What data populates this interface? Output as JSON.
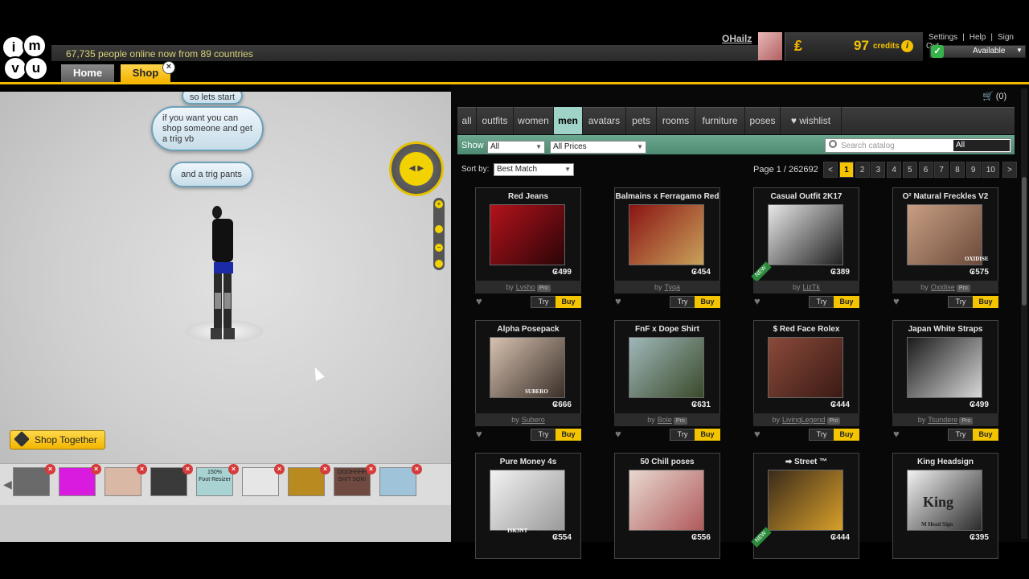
{
  "header": {
    "online_text": "67,735 people online now from 89 countries",
    "tabs": [
      {
        "label": "Home"
      },
      {
        "label": "Shop"
      }
    ],
    "tab_close": "×",
    "username": "OHailz",
    "credits": {
      "coin": "₤",
      "amount": "97",
      "label": "credits",
      "info": "i"
    },
    "links": [
      "Settings",
      "Help",
      "Sign Out"
    ],
    "link_sep": "|",
    "status": {
      "check": "✓",
      "label": "Available",
      "arrow": "▼"
    }
  },
  "scene": {
    "bubbles": [
      {
        "text": "so lets start"
      },
      {
        "text": "if you want you can shop someone and get a trig vb"
      },
      {
        "text": "and a trig pants"
      }
    ],
    "cam_label": "◀ ▶",
    "zoom": {
      "plus": "+",
      "minus": "−"
    },
    "shop_together_label": "Shop Together",
    "strip_arrow": "◀",
    "thumb_close": "×",
    "thumbs": [
      {
        "color": "#6a6a6a"
      },
      {
        "color": "#d91adf"
      },
      {
        "color": "#d9b9a5"
      },
      {
        "color": "#3a3a3a"
      },
      {
        "color": "#a9d3d3"
      },
      {
        "color": "#e6e6e6"
      },
      {
        "color": "#b88a1f"
      },
      {
        "color": "#704a40"
      },
      {
        "color": "#9fc3d8"
      }
    ],
    "thumb_texts": [
      "150%\nFoot Resizer",
      "OOOHHHH\nSHIT SON!"
    ]
  },
  "catalog": {
    "cart": "🛒 (0)",
    "categories": [
      {
        "label": "all"
      },
      {
        "label": "outfits"
      },
      {
        "label": "women"
      },
      {
        "label": "men"
      },
      {
        "label": "avatars"
      },
      {
        "label": "pets"
      },
      {
        "label": "rooms"
      },
      {
        "label": "furniture"
      },
      {
        "label": "poses"
      },
      {
        "label": "♥ wishlist"
      }
    ],
    "active_category": "men",
    "filter": {
      "show_label": "Show",
      "show_value": "All",
      "price_value": "All Prices",
      "search_placeholder": "Search catalog",
      "search_scope": "All"
    },
    "sort": {
      "label": "Sort by:",
      "value": "Best Match"
    },
    "pagination": {
      "label": "Page 1 / 262692",
      "prev": "<",
      "next": ">",
      "pages": [
        "1",
        "2",
        "3",
        "4",
        "5",
        "6",
        "7",
        "8",
        "9",
        "10"
      ],
      "current": "1"
    },
    "buttons": {
      "try": "Try",
      "buy": "Buy",
      "heart": "♥",
      "new": "NEW",
      "pro": "Pro",
      "by": "by"
    },
    "products": [
      {
        "title": "Red Jeans",
        "price": "₢499",
        "creator": "Lvsho",
        "pro": true,
        "img": [
          "#b3121b",
          "#2a0507"
        ],
        "new": false
      },
      {
        "title": "Balmains x Ferragamo Red",
        "price": "₢454",
        "creator": "Tyqa",
        "pro": false,
        "img": [
          "#8a1414",
          "#c9a25a"
        ],
        "new": false
      },
      {
        "title": "Casual Outfit 2K17",
        "price": "₢389",
        "creator": "LizTk",
        "pro": false,
        "img": [
          "#e8e8e8",
          "#202020"
        ],
        "new": true
      },
      {
        "title": "O² Natural Freckles V2",
        "price": "₢575",
        "creator": "Oxidise",
        "pro": true,
        "img": [
          "#c99f84",
          "#6b4a3a"
        ],
        "new": false
      },
      {
        "title": "Alpha Posepack",
        "price": "₢666",
        "creator": "Subero",
        "pro": false,
        "img": [
          "#d7c2b0",
          "#3a2f28"
        ],
        "new": false
      },
      {
        "title": "FnF x Dope Shirt",
        "price": "₢631",
        "creator": "Bole",
        "pro": true,
        "img": [
          "#9fb7b9",
          "#3a4a2a"
        ],
        "new": false
      },
      {
        "title": "$ Red Face Rolex",
        "price": "₢444",
        "creator": "LivingLegend",
        "pro": true,
        "img": [
          "#8a4a3a",
          "#3a1a14"
        ],
        "new": false
      },
      {
        "title": "Japan White Straps",
        "price": "₢499",
        "creator": "Tsundere",
        "pro": true,
        "img": [
          "#1a1a1a",
          "#d8d8d8"
        ],
        "new": false
      },
      {
        "title": "Pure Money 4s",
        "price": "₢554",
        "creator": "",
        "pro": false,
        "img": [
          "#f2f2f2",
          "#9a9a9a"
        ],
        "new": false
      },
      {
        "title": "50 Chill poses",
        "price": "₢556",
        "creator": "",
        "pro": false,
        "img": [
          "#e8d8d0",
          "#b05a5a"
        ],
        "new": false
      },
      {
        "title": "➡ Street ™",
        "price": "₢444",
        "creator": "",
        "pro": false,
        "img": [
          "#3a2a1a",
          "#d8a02a"
        ],
        "new": true
      },
      {
        "title": "King Headsign",
        "price": "₢395",
        "creator": "",
        "pro": false,
        "img": [
          "#f2f2f2",
          "#2a2a2a"
        ],
        "new": false
      }
    ],
    "image_texts": [
      "ISK3NT",
      "King",
      "M Head Sign",
      "OXIDISE",
      "SUBERO"
    ]
  }
}
